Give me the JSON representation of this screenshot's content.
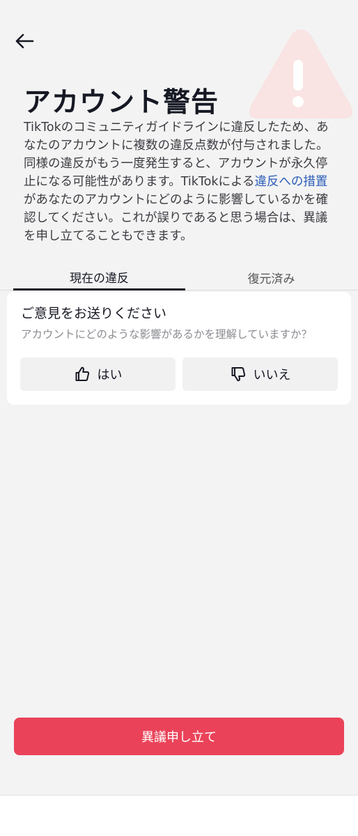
{
  "header": {
    "back_icon": "arrow-left-icon",
    "warning_icon": "warning-triangle-icon"
  },
  "page": {
    "title": "アカウント警告",
    "description_before_link": "TikTokのコミュニティガイドラインに違反したため、あなたのアカウントに複数の違反点数が付与されました。同様の違反がもう一度発生すると、アカウントが永久停止になる可能性があります。TikTokによる",
    "description_link": "違反への措置",
    "description_after_link": "があなたのアカウントにどのように影響しているかを確認してください。これが誤りであると思う場合は、異議を申し立てることもできます。"
  },
  "tabs": [
    {
      "label": "現在の違反",
      "active": true
    },
    {
      "label": "復元済み",
      "active": false
    }
  ],
  "feedback": {
    "title": "ご意見をお送りください",
    "question": "アカウントにどのような影響があるかを理解していますか？",
    "yes_label": "はい",
    "yes_icon": "thumbs-up-icon",
    "no_label": "いいえ",
    "no_icon": "thumbs-down-icon"
  },
  "actions": {
    "appeal_label": "異議申し立て"
  },
  "colors": {
    "accent": "#ea4359",
    "link": "#2b5db9",
    "warning_bg": "#f9e3e3"
  }
}
